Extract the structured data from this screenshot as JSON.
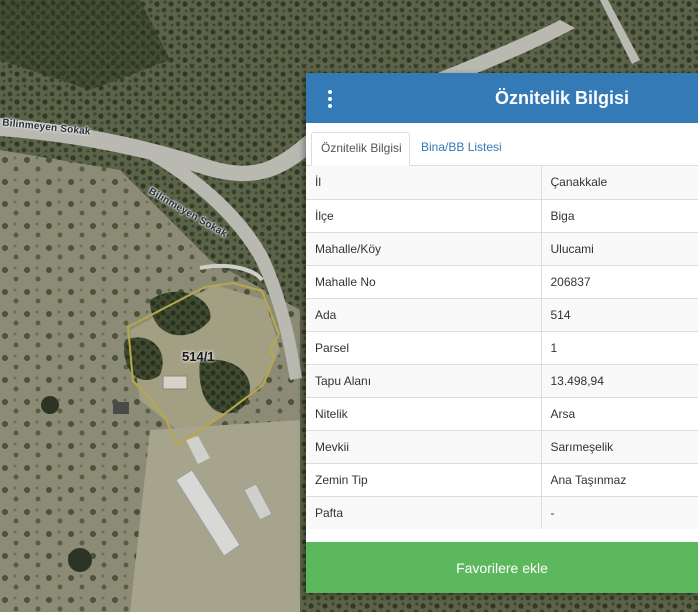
{
  "map": {
    "road_labels": [
      "Bilinmeyen Sokak",
      "Bilinmeyen Sokak"
    ],
    "parcel_label": "514/1",
    "colors": {
      "parcel_outline": "#b8a84a",
      "road": "#b9b9b2"
    }
  },
  "panel": {
    "title": "Öznitelik Bilgisi",
    "menu_icon": "vertical-ellipsis-icon",
    "header_color": "#337ab7",
    "tabs": [
      {
        "label": "Öznitelik Bilgisi",
        "active": true
      },
      {
        "label": "Bina/BB Listesi",
        "active": false
      }
    ],
    "rows": [
      {
        "key": "İl",
        "value": "Çanakkale"
      },
      {
        "key": "İlçe",
        "value": "Biga"
      },
      {
        "key": "Mahalle/Köy",
        "value": "Ulucami"
      },
      {
        "key": "Mahalle No",
        "value": "206837"
      },
      {
        "key": "Ada",
        "value": "514"
      },
      {
        "key": "Parsel",
        "value": "1"
      },
      {
        "key": "Tapu Alanı",
        "value": "13.498,94"
      },
      {
        "key": "Nitelik",
        "value": "Arsa"
      },
      {
        "key": "Mevkii",
        "value": "Sarımeşelik"
      },
      {
        "key": "Zemin Tip",
        "value": "Ana Taşınmaz"
      },
      {
        "key": "Pafta",
        "value": "-"
      }
    ],
    "favorite_button": "Favorilere ekle",
    "favorite_color": "#5cb85c"
  }
}
